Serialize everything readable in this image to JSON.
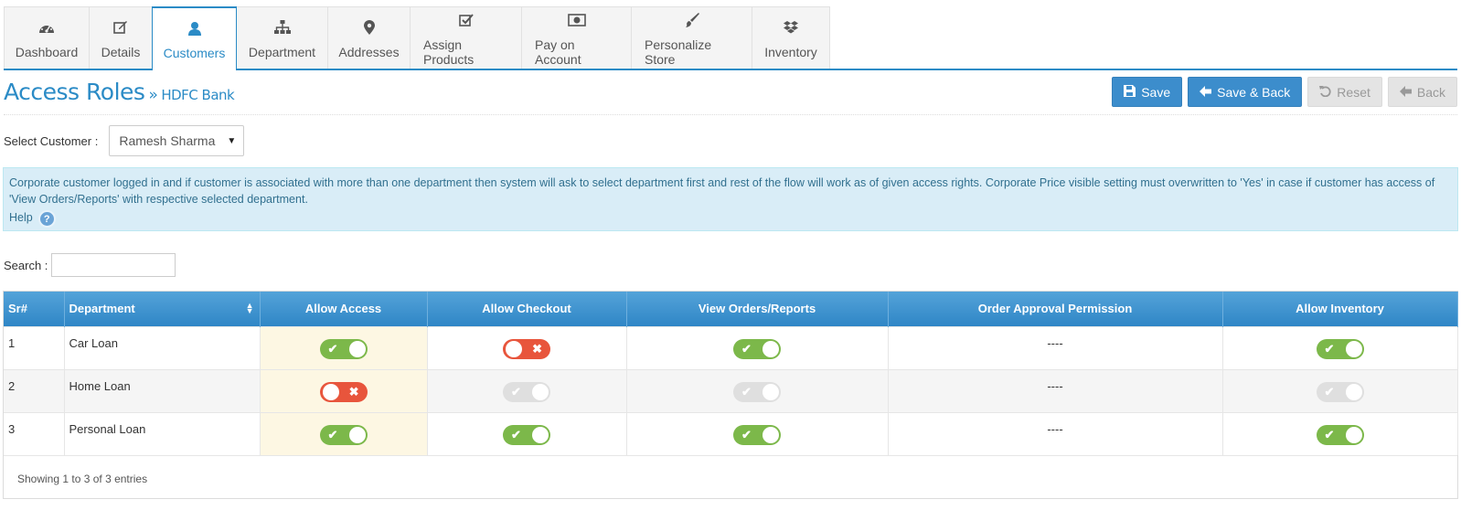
{
  "tabs": [
    {
      "label": "Dashboard",
      "icon": "dashboard-icon"
    },
    {
      "label": "Details",
      "icon": "edit-icon"
    },
    {
      "label": "Customers",
      "icon": "user-icon"
    },
    {
      "label": "Department",
      "icon": "sitemap-icon"
    },
    {
      "label": "Addresses",
      "icon": "map-marker-icon"
    },
    {
      "label": "Assign Products",
      "icon": "check-square-icon"
    },
    {
      "label": "Pay on Account",
      "icon": "money-icon"
    },
    {
      "label": "Personalize Store",
      "icon": "paint-brush-icon"
    },
    {
      "label": "Inventory",
      "icon": "dropbox-icon"
    }
  ],
  "active_tab": "Customers",
  "header": {
    "title": "Access Roles",
    "separator": "»",
    "subtitle": "HDFC Bank"
  },
  "buttons": {
    "save": "Save",
    "save_back": "Save & Back",
    "reset": "Reset",
    "back": "Back"
  },
  "select_customer": {
    "label": "Select Customer :",
    "value": "Ramesh Sharma"
  },
  "info": {
    "text": "Corporate customer logged in and if customer is associated with more than one department then system will ask to select department first and rest of the flow will work as of given access rights. Corporate Price visible setting must overwritten to 'Yes' in case if customer has access of 'View Orders/Reports' with respective selected department.",
    "help_label": "Help",
    "help_icon_text": "?"
  },
  "search": {
    "label": "Search :",
    "value": ""
  },
  "table": {
    "headers": [
      "Sr#",
      "Department",
      "Allow Access",
      "Allow Checkout",
      "View Orders/Reports",
      "Order Approval Permission",
      "Allow Inventory"
    ],
    "rows": [
      {
        "sr": "1",
        "department": "Car Loan",
        "allow_access": "on",
        "allow_checkout": "off",
        "view_orders": "on",
        "order_approval": "----",
        "allow_inventory": "on"
      },
      {
        "sr": "2",
        "department": "Home Loan",
        "allow_access": "off",
        "allow_checkout": "disabled",
        "view_orders": "disabled",
        "order_approval": "----",
        "allow_inventory": "disabled"
      },
      {
        "sr": "3",
        "department": "Personal Loan",
        "allow_access": "on",
        "allow_checkout": "on",
        "view_orders": "on",
        "order_approval": "----",
        "allow_inventory": "on"
      }
    ],
    "footer": "Showing 1 to 3 of 3 entries"
  },
  "colors": {
    "accent": "#2b8bc6",
    "toggle_on": "#7cb84a",
    "toggle_off": "#e8553c",
    "toggle_disabled": "#dfdfdf",
    "info_bg": "#d9edf7"
  }
}
